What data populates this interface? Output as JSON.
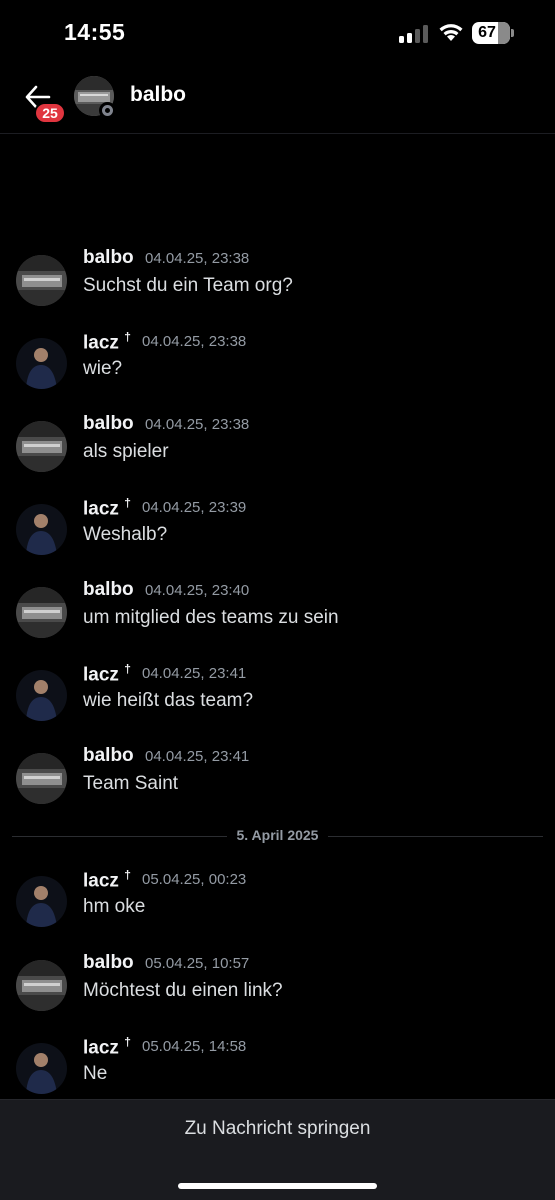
{
  "status_bar": {
    "time": "14:55",
    "battery": "67"
  },
  "header": {
    "badge_count": "25",
    "contact_name": "balbo"
  },
  "messages": [
    {
      "author": "balbo",
      "time": "04.04.25, 23:38",
      "text": "Suchst du ein Team org?"
    },
    {
      "author": "lacz",
      "time": "04.04.25, 23:38",
      "text": "wie?"
    },
    {
      "author": "balbo",
      "time": "04.04.25, 23:38",
      "text": "als spieler"
    },
    {
      "author": "lacz",
      "time": "04.04.25, 23:39",
      "text": "Weshalb?"
    },
    {
      "author": "balbo",
      "time": "04.04.25, 23:40",
      "text": "um mitglied des teams zu sein"
    },
    {
      "author": "lacz",
      "time": "04.04.25, 23:41",
      "text": "wie heißt das team?"
    },
    {
      "author": "balbo",
      "time": "04.04.25, 23:41",
      "text": "Team Saint"
    },
    {
      "author": "lacz",
      "time": "05.04.25, 00:23",
      "text": "hm oke"
    },
    {
      "author": "balbo",
      "time": "05.04.25, 10:57",
      "text": "Möchtest du einen link?"
    },
    {
      "author": "lacz",
      "time": "05.04.25, 14:58",
      "text": "Ne"
    }
  ],
  "author_marker": "†",
  "date_divider": "5. April 2025",
  "jump_button": "Zu Nachricht springen",
  "colors": {
    "background": "#000000",
    "badge": "#e0353f",
    "timestamp": "#949ba4",
    "jump_bar": "#1a1b1f"
  }
}
